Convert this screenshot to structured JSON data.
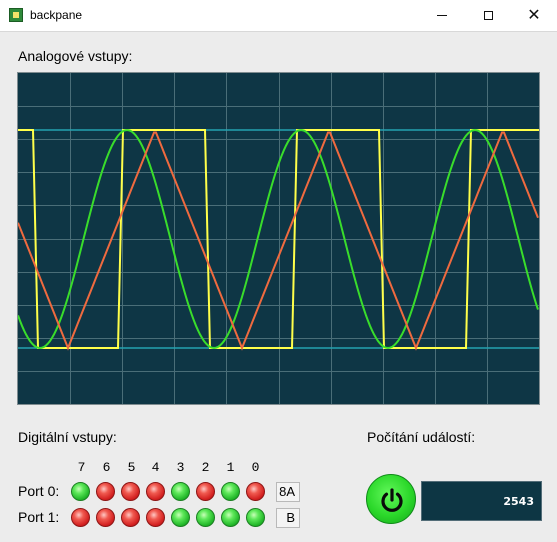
{
  "window": {
    "title": "backpane",
    "icon": "app-icon"
  },
  "analog": {
    "label": "Analogové vstupy:",
    "colors": {
      "background": "#0e3645",
      "grid": "#4a6e78",
      "reference": "#24a2b0",
      "square": "#ffff4a",
      "sine": "#39dd2b",
      "triangle": "#ef6a3f"
    }
  },
  "digital": {
    "label": "Digitální vstupy:",
    "bits": [
      "7",
      "6",
      "5",
      "4",
      "3",
      "2",
      "1",
      "0"
    ],
    "ports": [
      {
        "label": "Port 0:",
        "leds": [
          true,
          false,
          false,
          false,
          true,
          false,
          true,
          false
        ],
        "hex": "8A"
      },
      {
        "label": "Port 1:",
        "leds": [
          false,
          false,
          false,
          false,
          true,
          true,
          true,
          true
        ],
        "hex": "B"
      }
    ],
    "colors": {
      "on": "#2ad12d",
      "off": "#d91f1f"
    }
  },
  "events": {
    "label": "Počítání událostí:",
    "count": "2543",
    "power_icon": "power-icon"
  }
}
